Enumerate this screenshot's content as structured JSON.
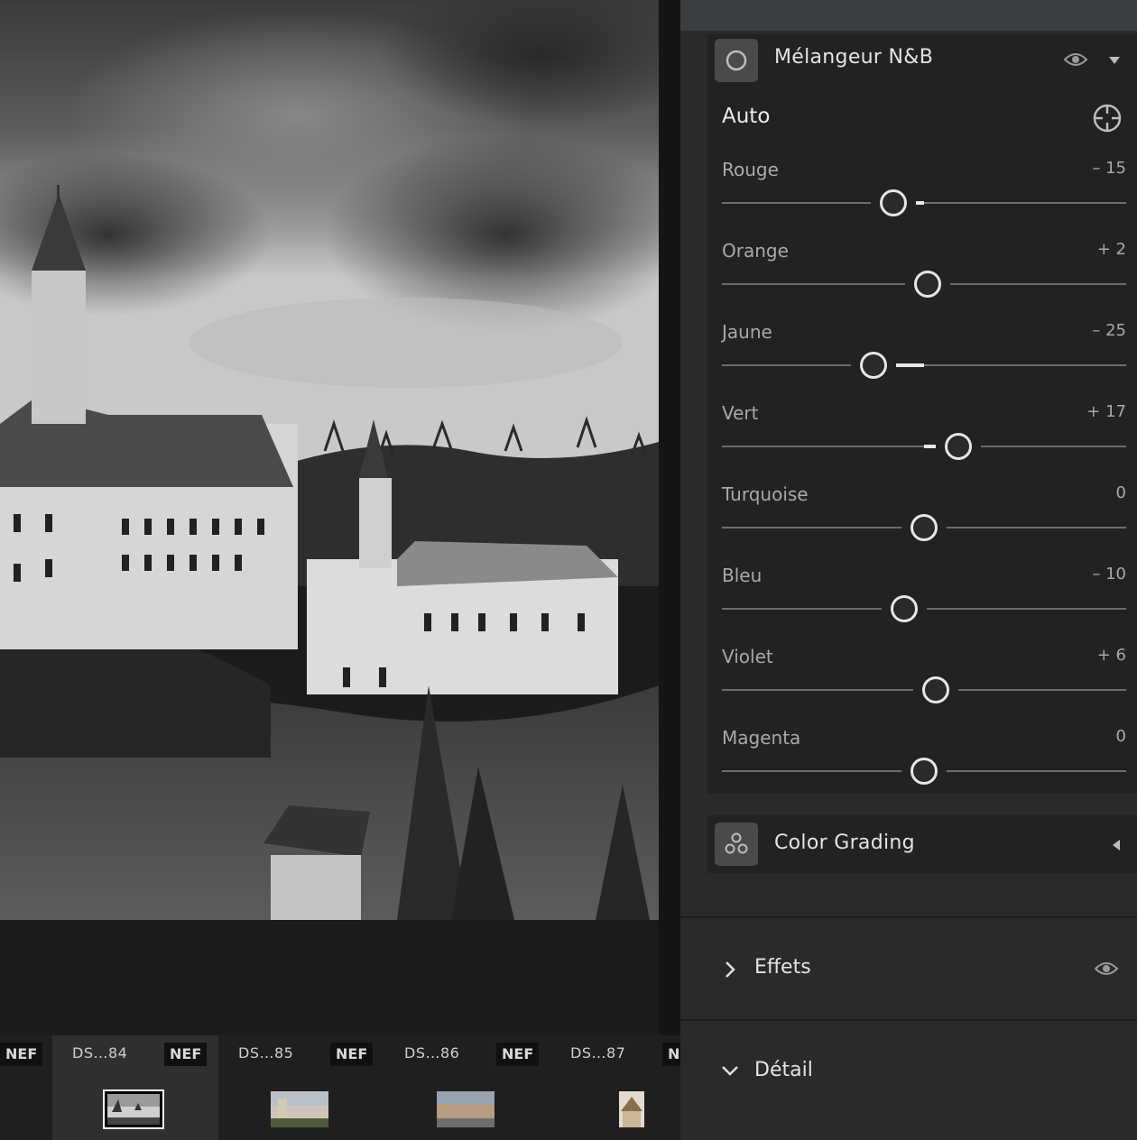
{
  "filmstrip": {
    "cells": [
      {
        "name": "",
        "badge": "NEF"
      },
      {
        "name": "DS…84",
        "badge": "NEF"
      },
      {
        "name": "DS…85",
        "badge": "NEF"
      },
      {
        "name": "DS…86",
        "badge": "NEF"
      },
      {
        "name": "DS…87",
        "badge": "N"
      }
    ]
  },
  "panel": {
    "bw_mixer": {
      "title": "Mélangeur N&B",
      "auto_label": "Auto",
      "sliders": [
        {
          "label": "Rouge",
          "value": "– 15",
          "amount": -15
        },
        {
          "label": "Orange",
          "value": "+ 2",
          "amount": 2
        },
        {
          "label": "Jaune",
          "value": "– 25",
          "amount": -25
        },
        {
          "label": "Vert",
          "value": "+ 17",
          "amount": 17
        },
        {
          "label": "Turquoise",
          "value": "0",
          "amount": 0
        },
        {
          "label": "Bleu",
          "value": "– 10",
          "amount": -10
        },
        {
          "label": "Violet",
          "value": "+ 6",
          "amount": 6
        },
        {
          "label": "Magenta",
          "value": "0",
          "amount": 0
        }
      ],
      "slider_range": [
        -100,
        100
      ]
    },
    "color_grading": {
      "title": "Color Grading"
    },
    "effets": {
      "title": "Effets"
    },
    "detail": {
      "title": "Détail"
    }
  },
  "icons": {
    "bw_mixer": "circle-icon",
    "visibility": "eye-icon",
    "collapse": "triangle-down-icon",
    "targeted_adjust": "crosshair-icon",
    "color_grading": "three-circles-icon",
    "expand_grading": "triangle-left-icon",
    "effets_toggle": "chevron-right-icon",
    "detail_toggle": "chevron-down-icon"
  }
}
